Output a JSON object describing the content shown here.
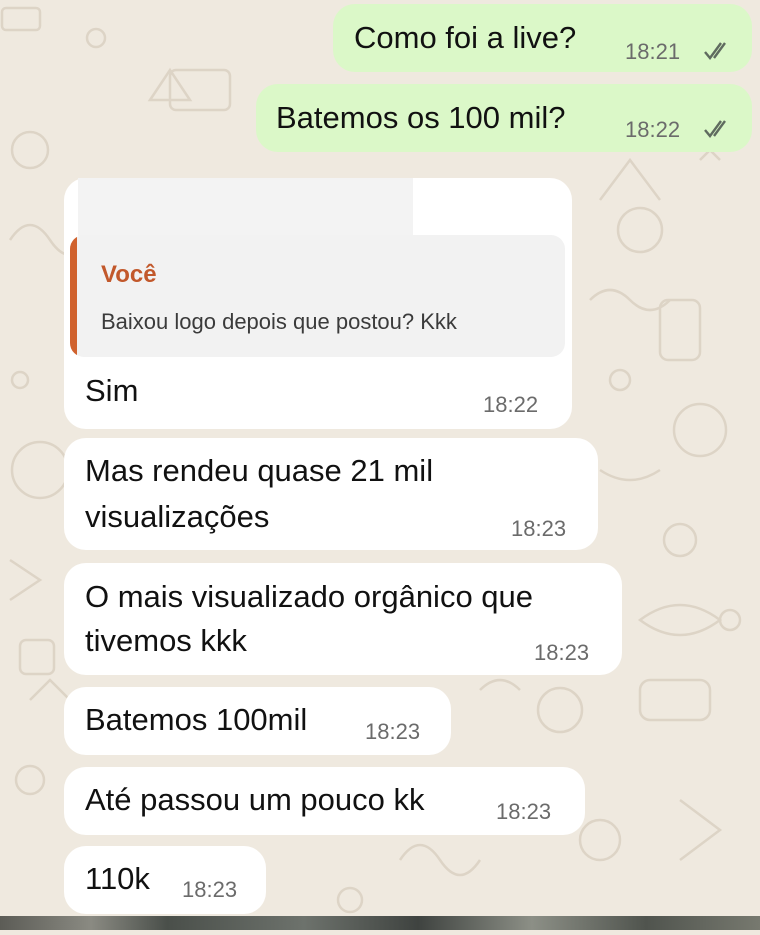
{
  "chat": {
    "messages": [
      {
        "direction": "outgoing",
        "text": "Como foi a live?",
        "time": "18:21",
        "status": "read"
      },
      {
        "direction": "outgoing",
        "text": "Batemos os 100 mil?",
        "time": "18:22",
        "status": "read"
      },
      {
        "direction": "incoming",
        "quoted": {
          "author": "Você",
          "text": "Baixou logo depois que postou? Kkk"
        },
        "text": "Sim",
        "time": "18:22"
      },
      {
        "direction": "incoming",
        "text_line1": "Mas rendeu quase 21 mil",
        "text_line2": "visualizações",
        "time": "18:23"
      },
      {
        "direction": "incoming",
        "text_line1": "O mais visualizado orgânico que",
        "text_line2": "tivemos kkk",
        "time": "18:23"
      },
      {
        "direction": "incoming",
        "text": "Batemos 100mil",
        "time": "18:23"
      },
      {
        "direction": "incoming",
        "text": "Até passou um pouco kk",
        "time": "18:23"
      },
      {
        "direction": "incoming",
        "text": "110k",
        "time": "18:23"
      }
    ]
  },
  "colors": {
    "wallpaper": "#efe9df",
    "outgoing_bubble": "#dbf8c8",
    "incoming_bubble": "#ffffff",
    "quote_accent": "#d0622e",
    "read_tick": "#5f6b5f"
  },
  "icons": [
    "double-check-icon"
  ]
}
